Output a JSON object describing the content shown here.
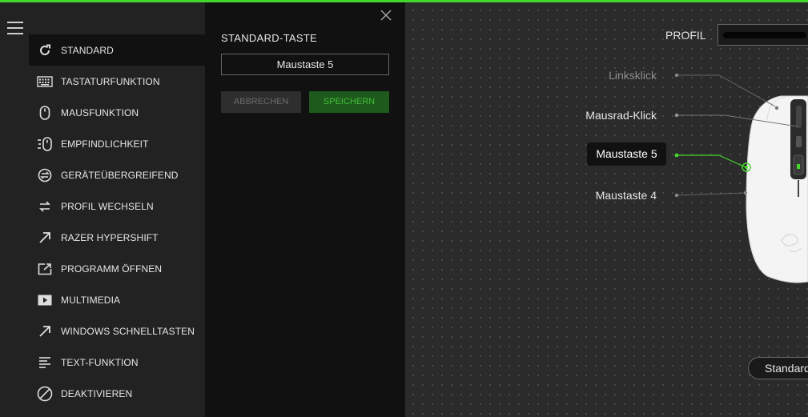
{
  "menu": {
    "items": [
      {
        "label": "STANDARD",
        "icon": "refresh-icon"
      },
      {
        "label": "TASTATURFUNKTION",
        "icon": "keyboard-icon"
      },
      {
        "label": "MAUSFUNKTION",
        "icon": "mouse-icon"
      },
      {
        "label": "EMPFINDLICHKEIT",
        "icon": "sensitivity-icon"
      },
      {
        "label": "GERÄTEÜBERGREIFEND",
        "icon": "inter-device-icon"
      },
      {
        "label": "PROFIL WECHSELN",
        "icon": "swap-icon"
      },
      {
        "label": "RAZER HYPERSHIFT",
        "icon": "hypershift-arrow-icon"
      },
      {
        "label": "PROGRAMM ÖFFNEN",
        "icon": "open-program-icon"
      },
      {
        "label": "MULTIMEDIA",
        "icon": "multimedia-play-icon"
      },
      {
        "label": "WINDOWS SCHNELLTASTEN",
        "icon": "shortcut-arrow-icon"
      },
      {
        "label": "TEXT-FUNKTION",
        "icon": "text-lines-icon"
      },
      {
        "label": "DEAKTIVIEREN",
        "icon": "disable-icon"
      }
    ],
    "active_index": 0
  },
  "panel": {
    "title": "STANDARD-TASTE",
    "key_value": "Maustaste 5",
    "cancel_label": "ABBRECHEN",
    "save_label": "SPEICHERN"
  },
  "canvas": {
    "profile_label": "PROFIL",
    "button_labels": {
      "left_click": "Linksklick",
      "wheel_click": "Mausrad-Klick",
      "mouse5": "Maustaste 5",
      "mouse4": "Maustaste 4"
    },
    "mode_pill": "Standard"
  },
  "colors": {
    "accent": "#44d62c",
    "save_bg": "#1d5a1c",
    "save_text": "#43bf3a"
  }
}
